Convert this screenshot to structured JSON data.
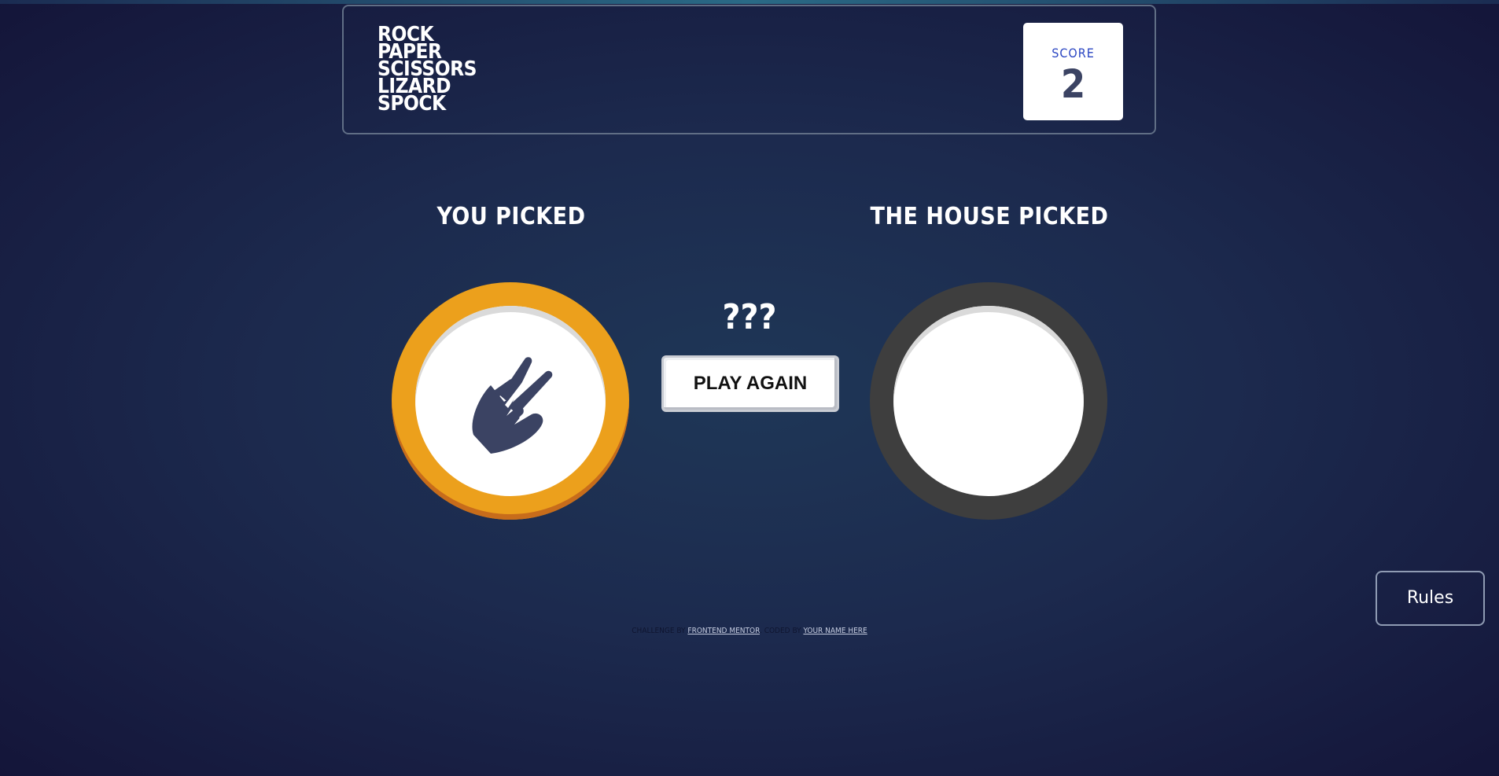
{
  "header": {
    "logo_words": [
      "ROCK",
      "PAPER",
      "SCISSORS",
      "LIZARD",
      "SPOCK"
    ],
    "score": {
      "label": "SCORE",
      "value": "2"
    }
  },
  "game": {
    "you_picked_label": "YOU PICKED",
    "house_picked_label": "THE HOUSE PICKED",
    "player_choice": {
      "name": "scissors",
      "icon": "scissors-icon",
      "ring_color": "#eca01c"
    },
    "house_choice": {
      "name": "",
      "ring_color": "#3e3e3e"
    },
    "result_text": "???",
    "play_again_label": "PLAY AGAIN"
  },
  "rules_button_label": "Rules",
  "attribution": {
    "challenge_prefix": "CHALLENGE BY",
    "challenge_link": "FRONTEND MENTOR",
    "coded_prefix": ". CODED BY",
    "coded_link": "YOUR NAME HERE"
  },
  "colors": {
    "background_center": "#1f3757",
    "background_edge": "#141539",
    "score_label": "#2a45c2",
    "score_value": "#3b4363",
    "header_border": "#606e85",
    "icon_fill": "#3b4363"
  }
}
